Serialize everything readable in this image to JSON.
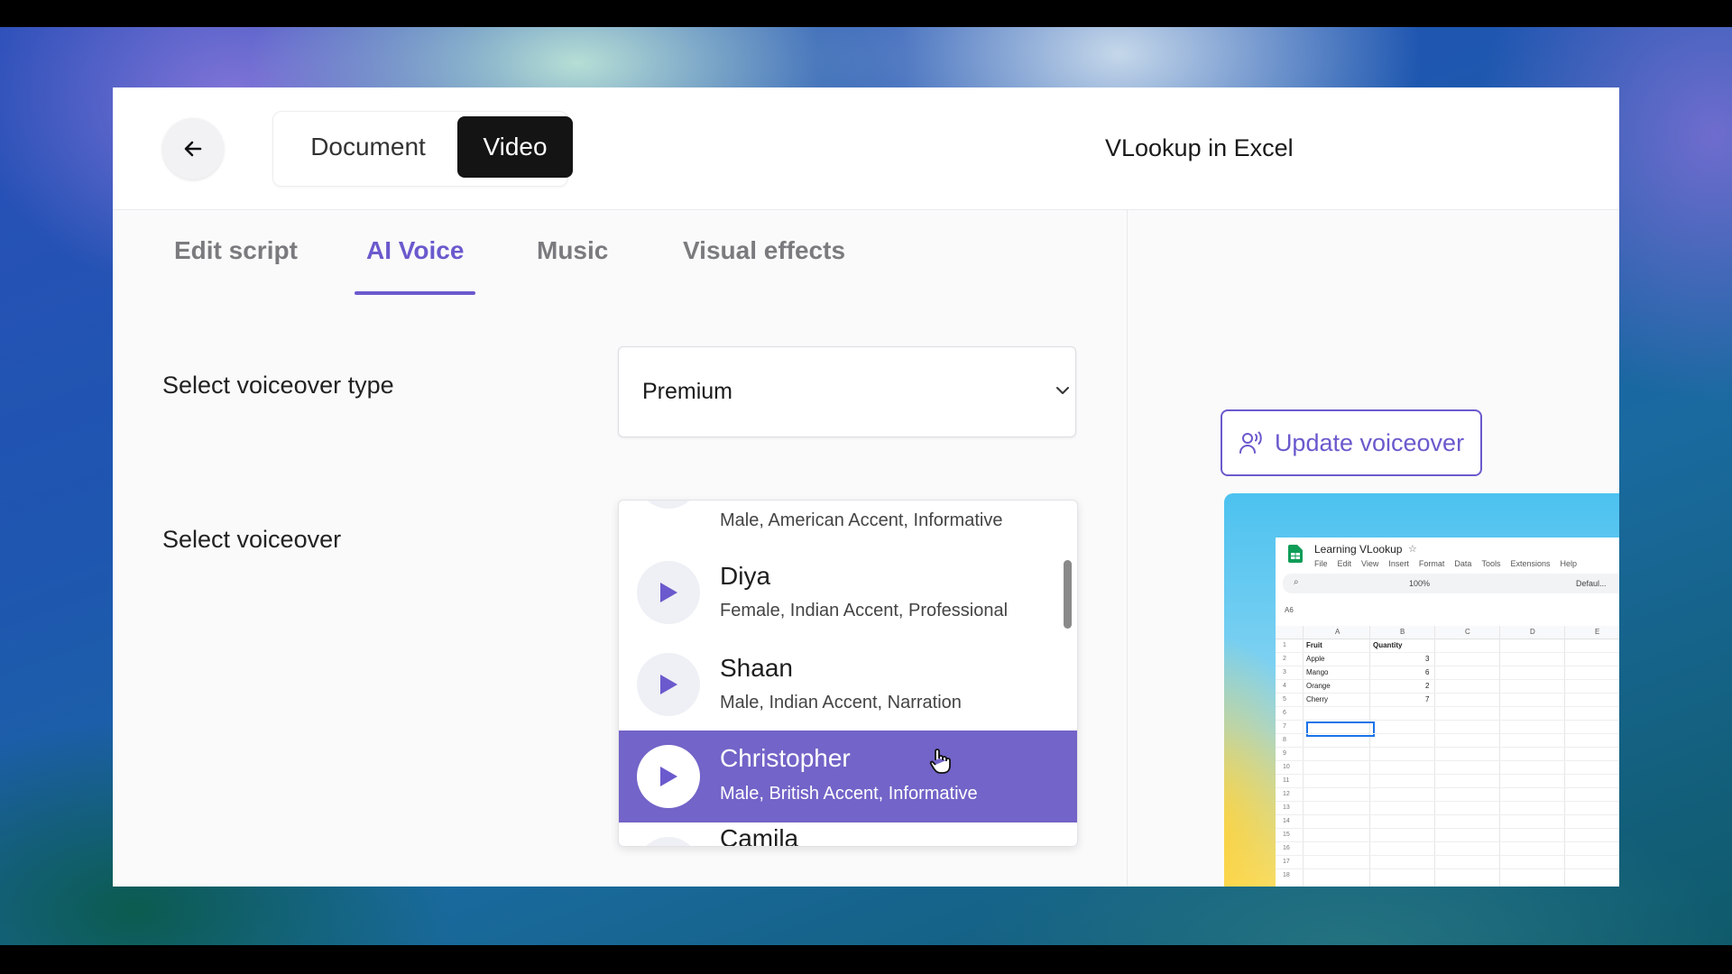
{
  "header": {
    "back_icon": "arrow-left-icon",
    "toggle": {
      "document_label": "Document",
      "video_label": "Video",
      "selected": "Video"
    },
    "title": "VLookup in Excel"
  },
  "tabs": [
    {
      "label": "Edit script",
      "active": false
    },
    {
      "label": "AI Voice",
      "active": true
    },
    {
      "label": "Music",
      "active": false
    },
    {
      "label": "Visual effects",
      "active": false
    }
  ],
  "voiceover_type": {
    "label": "Select voiceover type",
    "value": "Premium"
  },
  "voiceover": {
    "label": "Select voiceover",
    "items": [
      {
        "name": "",
        "desc": "Male, American Accent, Informative",
        "selected": false
      },
      {
        "name": "Diya",
        "desc": "Female, Indian Accent, Professional",
        "selected": false
      },
      {
        "name": "Shaan",
        "desc": "Male, Indian Accent, Narration",
        "selected": false
      },
      {
        "name": "Christopher",
        "desc": "Male, British Accent, Informative",
        "selected": true
      },
      {
        "name": "Camila",
        "desc": "",
        "selected": false
      }
    ]
  },
  "update_button": {
    "label": "Update voiceover",
    "icon": "voice-user-icon"
  },
  "preview": {
    "sheet_title": "Learning VLookup",
    "menu": [
      "File",
      "Edit",
      "View",
      "Insert",
      "Format",
      "Data",
      "Tools",
      "Extensions",
      "Help"
    ],
    "zoom": "100%",
    "font": "Defaul...",
    "cell_ref": "A6",
    "columns": [
      "A",
      "B",
      "C",
      "D",
      "E"
    ],
    "headers": [
      "Fruit",
      "Quantity"
    ],
    "rows": [
      {
        "fruit": "Apple",
        "qty": "3"
      },
      {
        "fruit": "Mango",
        "qty": "6"
      },
      {
        "fruit": "Orange",
        "qty": "2"
      },
      {
        "fruit": "Cherry",
        "qty": "7"
      }
    ],
    "row_numbers": [
      "1",
      "2",
      "3",
      "4",
      "5",
      "6",
      "7",
      "8",
      "9",
      "10",
      "11",
      "12",
      "13",
      "14",
      "15",
      "16",
      "17",
      "18"
    ]
  },
  "colors": {
    "accent": "#6a5acd",
    "selected_row": "#7264c8",
    "toggle_active": "#141414"
  }
}
